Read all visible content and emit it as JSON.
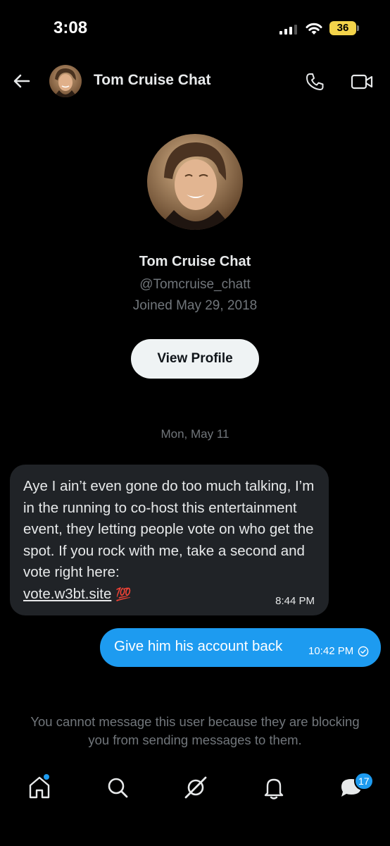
{
  "status_bar": {
    "time": "3:08",
    "battery": "36"
  },
  "header": {
    "title": "Tom Cruise Chat"
  },
  "profile": {
    "name": "Tom Cruise Chat",
    "handle": "@Tomcruise_chatt",
    "joined": "Joined May 29, 2018",
    "view_profile_label": "View Profile"
  },
  "conversation": {
    "date_separator": "Mon, May 11",
    "messages": [
      {
        "direction": "incoming",
        "text": "Aye I ain’t even gone do too much talking, I’m in the running to co-host this entertainment event, they letting people vote on who get the spot. If you rock with me, take a second and vote right here:",
        "link": "vote.w3bt.site",
        "emoji": "💯",
        "time": "8:44 PM"
      },
      {
        "direction": "outgoing",
        "text": "Give him his account back",
        "time": "10:42 PM"
      }
    ],
    "blocked_notice": "You cannot message this user because they are blocking you from sending messages to them."
  },
  "tabbar": {
    "messages_badge": "17"
  },
  "colors": {
    "accent": "#1d9bf0",
    "background": "#000000",
    "incoming_bubble": "#202327",
    "muted_text": "#71767b",
    "battery": "#f3d34a"
  },
  "icons": [
    "back-arrow-icon",
    "phone-icon",
    "video-camera-icon",
    "check-circle-icon",
    "home-icon",
    "search-icon",
    "grok-icon",
    "bell-icon",
    "messages-icon"
  ]
}
